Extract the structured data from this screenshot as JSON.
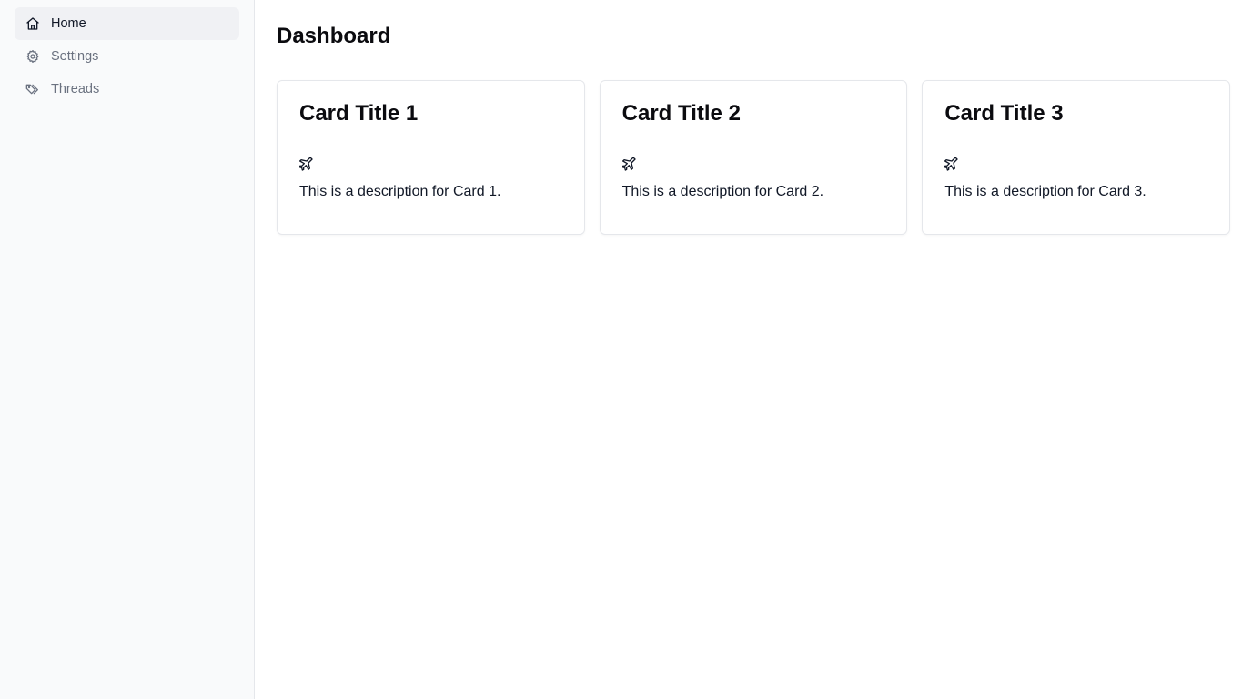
{
  "sidebar": {
    "items": [
      {
        "label": "Home",
        "icon": "home-icon",
        "active": true
      },
      {
        "label": "Settings",
        "icon": "gear-icon",
        "active": false
      },
      {
        "label": "Threads",
        "icon": "tags-icon",
        "active": false
      }
    ]
  },
  "main": {
    "title": "Dashboard",
    "cards": [
      {
        "title": "Card Title 1",
        "icon": "plane-icon",
        "description": "This is a description for Card 1."
      },
      {
        "title": "Card Title 2",
        "icon": "plane-icon",
        "description": "This is a description for Card 2."
      },
      {
        "title": "Card Title 3",
        "icon": "plane-icon",
        "description": "This is a description for Card 3."
      }
    ]
  },
  "colors": {
    "sidebar_bg": "#f9fafb",
    "active_item_bg": "#f0f1f4",
    "muted_text": "#6b7280",
    "border": "#e5e7eb"
  }
}
